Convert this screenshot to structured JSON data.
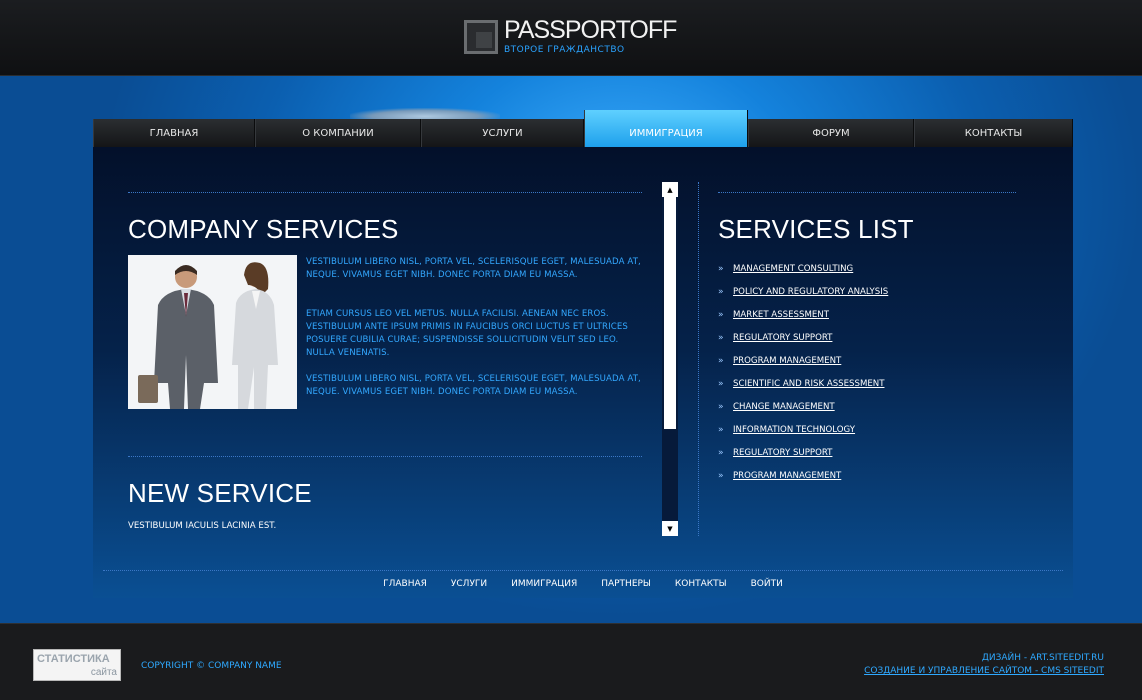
{
  "header": {
    "logo_title": "PASSPORTOFF",
    "logo_subtitle": "ВТОРОЕ ГРАЖДАНСТВО"
  },
  "nav": {
    "items": [
      {
        "label": "ГЛАВНАЯ"
      },
      {
        "label": "О КОМПАНИИ"
      },
      {
        "label": "УСЛУГИ"
      },
      {
        "label": "ИММИГРАЦИЯ",
        "active": true
      },
      {
        "label": "ФОРУМ"
      },
      {
        "label": "КОНТАКТЫ"
      }
    ]
  },
  "company": {
    "title": "COMPANY SERVICES",
    "paragraphs": [
      "Vestibulum libero nisl, porta vel, scelerisque eget, malesuada at, neque. Vivamus eget nibh. Donec porta diam eu massa.",
      "Etiam cursus leo vel metus. Nulla facilisi. Aenean nec eros. Vestibulum ante ipsum primis in faucibus orci luctus et ultrices posuere cubilia Curae; Suspendisse sollicitudin velit sed leo. Nulla venenatis.",
      "Vestibulum libero nisl, porta vel, scelerisque eget, malesuada at, neque. Vivamus eget nibh. Donec porta diam eu massa."
    ]
  },
  "new_service": {
    "title": "NEW SERVICE",
    "text": "Vestibulum iaculis lacinia est."
  },
  "services": {
    "title": "SERVICES LIST",
    "items": [
      "Management consulting",
      "Policy and regulatory analysis",
      "Market assessment",
      "Regulatory support",
      "Program management",
      "Scientific and risk assessment",
      "Change management",
      "Information technology",
      "Regulatory support",
      "Program management"
    ]
  },
  "footer_nav": [
    "ГЛАВНАЯ",
    "УСЛУГИ",
    "ИММИГРАЦИЯ",
    "ПАРТНЕРЫ",
    "КОНТАКТЫ",
    "ВОЙТИ"
  ],
  "bottom": {
    "stat_top": "СТАТИСТИКА",
    "stat_bottom": "сайта",
    "copyright": "COPYRIGHT © COMPANY NAME",
    "design_credit": "ДИЗАЙН - ART.SITEEDIT.RU",
    "cms_credit": "СОЗДАНИЕ И УПРАВЛЕНИЕ САЙТОМ - CMS SITEEDIT"
  },
  "colors": {
    "accent": "#33a8ff",
    "active_tab": "#5fd0ff"
  }
}
